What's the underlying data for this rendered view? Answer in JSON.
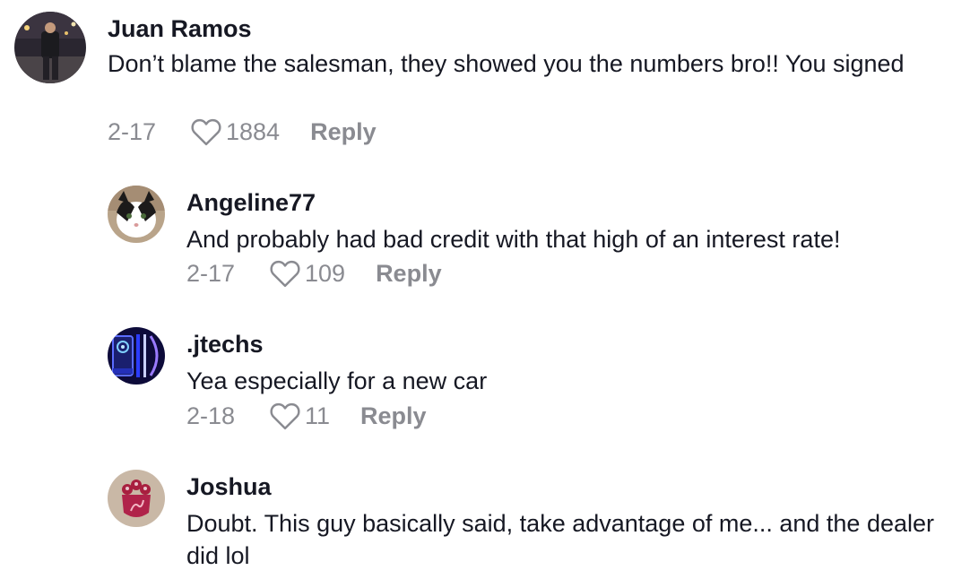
{
  "comments": [
    {
      "username": "Juan Ramos",
      "text": "Don’t blame the salesman, they showed you the numbers bro!! You signed",
      "date": "2-17",
      "likes": "1884",
      "reply_label": "Reply"
    },
    {
      "username": "Angeline77",
      "text": "And probably had bad credit with that high of an interest rate!",
      "date": "2-17",
      "likes": "109",
      "reply_label": "Reply"
    },
    {
      "username": ".jtechs",
      "text": "Yea especially for a new car",
      "date": "2-18",
      "likes": "11",
      "reply_label": "Reply"
    },
    {
      "username": "Joshua",
      "text": "Doubt. This guy basically said, take advantage of me... and the dealer did lol"
    }
  ],
  "colors": {
    "text": "#161823",
    "meta": "#8a8b91",
    "background": "#ffffff"
  },
  "icons": {
    "like": "heart-outline-icon"
  }
}
